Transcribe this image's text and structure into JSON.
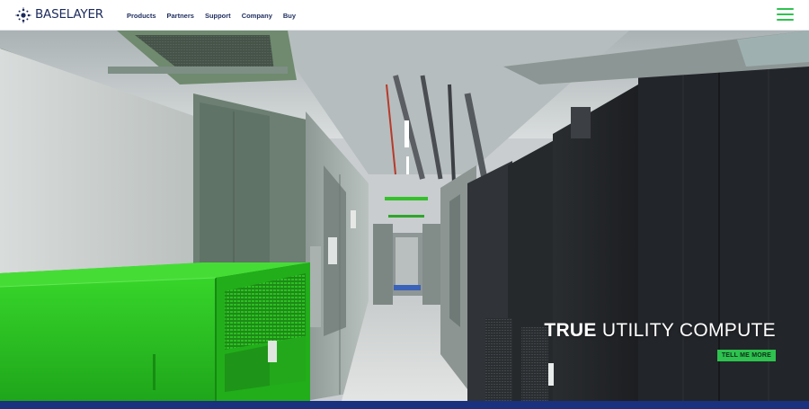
{
  "brand": {
    "name": "BASELAYER",
    "logo_icon": "dot-cluster-logo",
    "color": "#1b2a5c"
  },
  "nav": {
    "items": [
      {
        "label": "Products"
      },
      {
        "label": "Partners"
      },
      {
        "label": "Support"
      },
      {
        "label": "Company"
      },
      {
        "label": "Buy"
      }
    ]
  },
  "menu": {
    "icon": "hamburger-menu-icon",
    "color": "#2ec24f"
  },
  "hero": {
    "image": "data-center-corridor-photo",
    "title_strong": "TRUE",
    "title_light": "UTILITY COMPUTE",
    "cta_label": "TELL ME MORE",
    "cta_color": "#2ec24f"
  },
  "footer_bar": {
    "color": "#1a3180"
  }
}
